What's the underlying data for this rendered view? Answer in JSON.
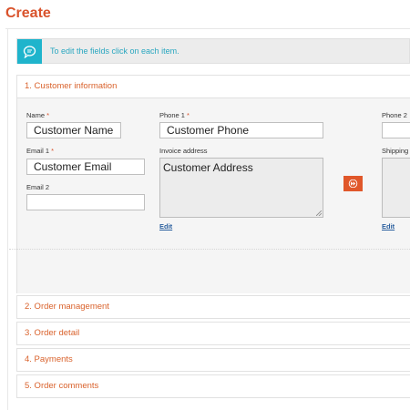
{
  "page": {
    "title": "Create"
  },
  "info": {
    "text": "To edit the fields click on each item."
  },
  "sections": [
    {
      "label": "1. Customer information"
    },
    {
      "label": "2. Order management"
    },
    {
      "label": "3. Order detail"
    },
    {
      "label": "4. Payments"
    },
    {
      "label": "5. Order comments"
    }
  ],
  "customer": {
    "name_label": "Name",
    "name_value": "Customer Name",
    "phone1_label": "Phone 1",
    "phone1_value": "Customer Phone",
    "phone2_label": "Phone 2",
    "email1_label": "Email 1",
    "email1_value": "Customer Email",
    "email2_label": "Email 2",
    "email2_value": "",
    "invoice_label": "Invoice address",
    "invoice_value": "Customer Address",
    "shipping_label": "Shipping",
    "required_mark": "*",
    "edit_label": "Edit"
  },
  "colors": {
    "accent": "#d9532c",
    "info": "#1fb4cc",
    "link": "#2a5f9e"
  },
  "icons": {
    "info": "speech-bubble-icon",
    "copy": "fast-forward-icon"
  }
}
